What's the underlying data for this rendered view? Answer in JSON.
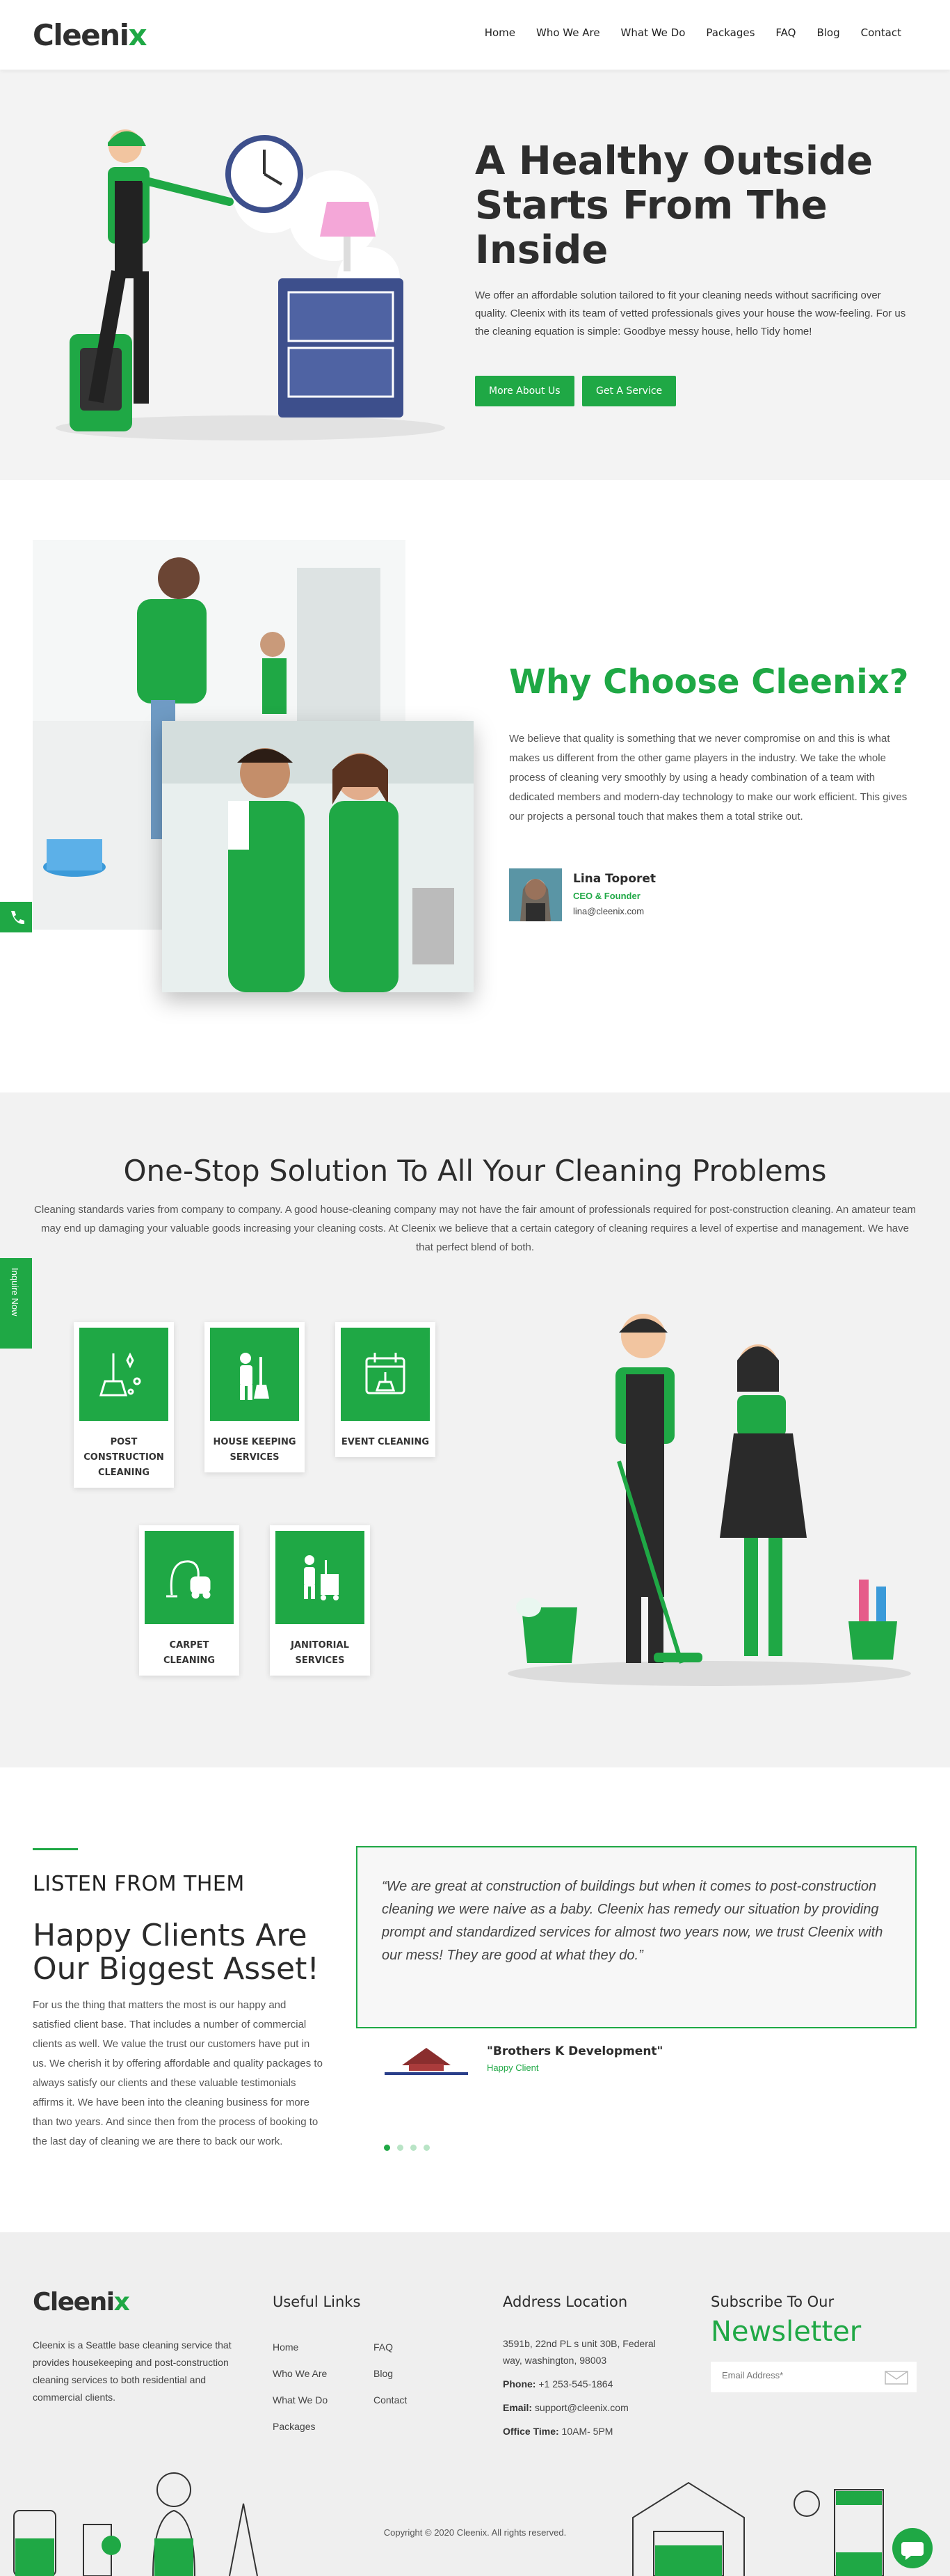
{
  "header": {
    "logo_main": "Cleeni",
    "logo_accent": "x",
    "nav": [
      "Home",
      "Who We Are",
      "What We Do",
      "Packages",
      "FAQ",
      "Blog",
      "Contact"
    ]
  },
  "hero": {
    "title": "A Healthy Outside Starts From The Inside",
    "text": "We offer an affordable solution tailored to fit your cleaning needs without sacrificing over quality. Cleenix with its team of vetted professionals gives your house the wow-feeling. For us the cleaning equation is simple: Goodbye messy house, hello Tidy home!",
    "btn_about": "More About Us",
    "btn_service": "Get A Service"
  },
  "why": {
    "title": "Why Choose Cleenix?",
    "text": "We believe that quality is something that we never compromise on and this is what makes us different from the other game players in the industry. We take the whole process of cleaning very smoothly by using a heady combination of a team with dedicated members and modern-day technology to make our work efficient. This gives our projects a personal touch that makes them a total strike out.",
    "author_name": "Lina Toporet",
    "author_role": "CEO & Founder",
    "author_email": "lina@cleenix.com"
  },
  "side": {
    "inquire": "Inquire Now"
  },
  "services": {
    "title": "One-Stop Solution To All Your Cleaning Problems",
    "text": "Cleaning standards varies from company to company. A good house-cleaning company may not have the fair amount of professionals required for post-construction cleaning. An amateur team may end up damaging your valuable goods increasing your cleaning costs. At Cleenix we believe that a certain category of cleaning requires a level of expertise and management. We have that perfect blend of both.",
    "cards": [
      "POST CONSTRUCTION CLEANING",
      "HOUSE KEEPING SERVICES",
      "EVENT CLEANING",
      "CARPET CLEANING",
      "JANITORIAL SERVICES"
    ]
  },
  "testimonials": {
    "kicker": "LISTEN FROM THEM",
    "title": "Happy Clients Are Our Biggest Asset!",
    "text": "For us the thing that matters the most is our happy and satisfied client base. That includes a number of commercial clients as well. We value the trust our customers have put in us. We cherish it by offering affordable and quality packages to always satisfy our clients and these valuable testimonials affirms it. We have been into the cleaning business for more than two years. And since then from the process of booking to the last day of cleaning we are there to back our work.",
    "quote": "“We are great at construction of buildings but when it comes to post-construction cleaning we were naive as a baby. Cleenix has remedy our situation by providing prompt and standardized services for almost two years now, we trust Cleenix with our mess! They are good at what they do.”",
    "client_name": "\"Brothers K Development\"",
    "client_role": "Happy Client",
    "active_slide": 1,
    "slide_count": 4
  },
  "footer": {
    "logo_main": "Cleeni",
    "logo_accent": "x",
    "about": "Cleenix is a Seattle base cleaning service that provides housekeeping and post-construction cleaning services to both residential and commercial clients.",
    "useful_title": "Useful Links",
    "links_col1": [
      "Home",
      "Who We Are",
      "What We Do",
      "Packages"
    ],
    "links_col2": [
      "FAQ",
      "Blog",
      "Contact"
    ],
    "address_title": "Address Location",
    "address": "3591b, 22nd PL s unit 30B, Federal way, washington, 98003",
    "phone_label": "Phone:",
    "phone": "+1 253-545-1864",
    "email_label": "Email:",
    "email": "support@cleenix.com",
    "hours_label": "Office Time:",
    "hours": "10AM- 5PM",
    "subscribe_title": "Subscribe To Our",
    "newsletter": "Newsletter",
    "email_placeholder": "Email Address*",
    "copyright": "Copyright © 2020 Cleenix. All rights reserved."
  },
  "colors": {
    "brand": "#1fa845",
    "dark": "#2d2d2d",
    "light_bg": "#f2f2f2"
  }
}
